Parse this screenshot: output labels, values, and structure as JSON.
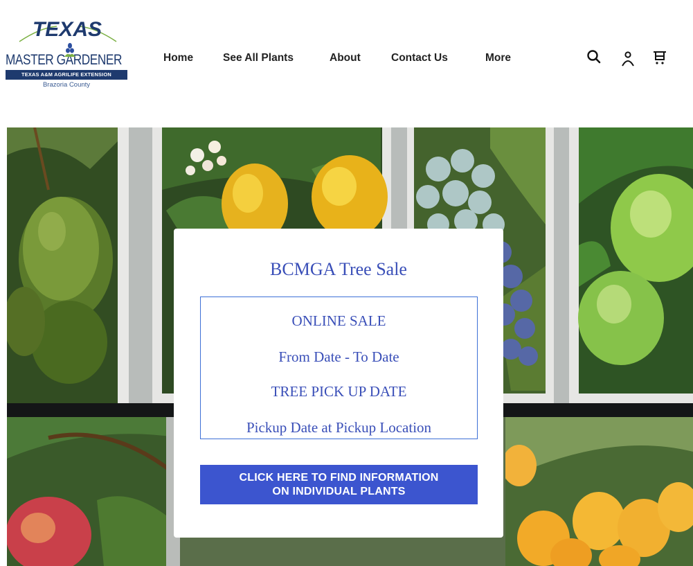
{
  "logo": {
    "top_text": "TEXAS",
    "main_text": "MASTER GARDENER",
    "band_text": "TEXAS A&M AGRILIFE EXTENSION",
    "county": "Brazoria County",
    "colors": {
      "navy": "#1e3a6e",
      "green": "#7bb043"
    }
  },
  "nav": {
    "items": [
      "Home",
      "See All Plants",
      "About",
      "Contact Us",
      "More"
    ]
  },
  "icons": [
    "search-icon",
    "account-icon",
    "cart-icon"
  ],
  "hero": {
    "panels": [
      "avocado",
      "lemons",
      "blueberries",
      "limes",
      "peaches",
      "citrus-oranges"
    ]
  },
  "card": {
    "title": "BCMGA Tree Sale",
    "lines": [
      "ONLINE SALE",
      "From Date - To Date",
      "TREE PICK UP DATE",
      "Pickup Date at Pickup Location"
    ],
    "cta_label_1": "CLICK HERE TO FIND INFORMATION",
    "cta_label_2": "ON INDIVIDUAL PLANTS",
    "colors": {
      "text": "#3a4fb8",
      "button": "#3c55cf"
    }
  }
}
